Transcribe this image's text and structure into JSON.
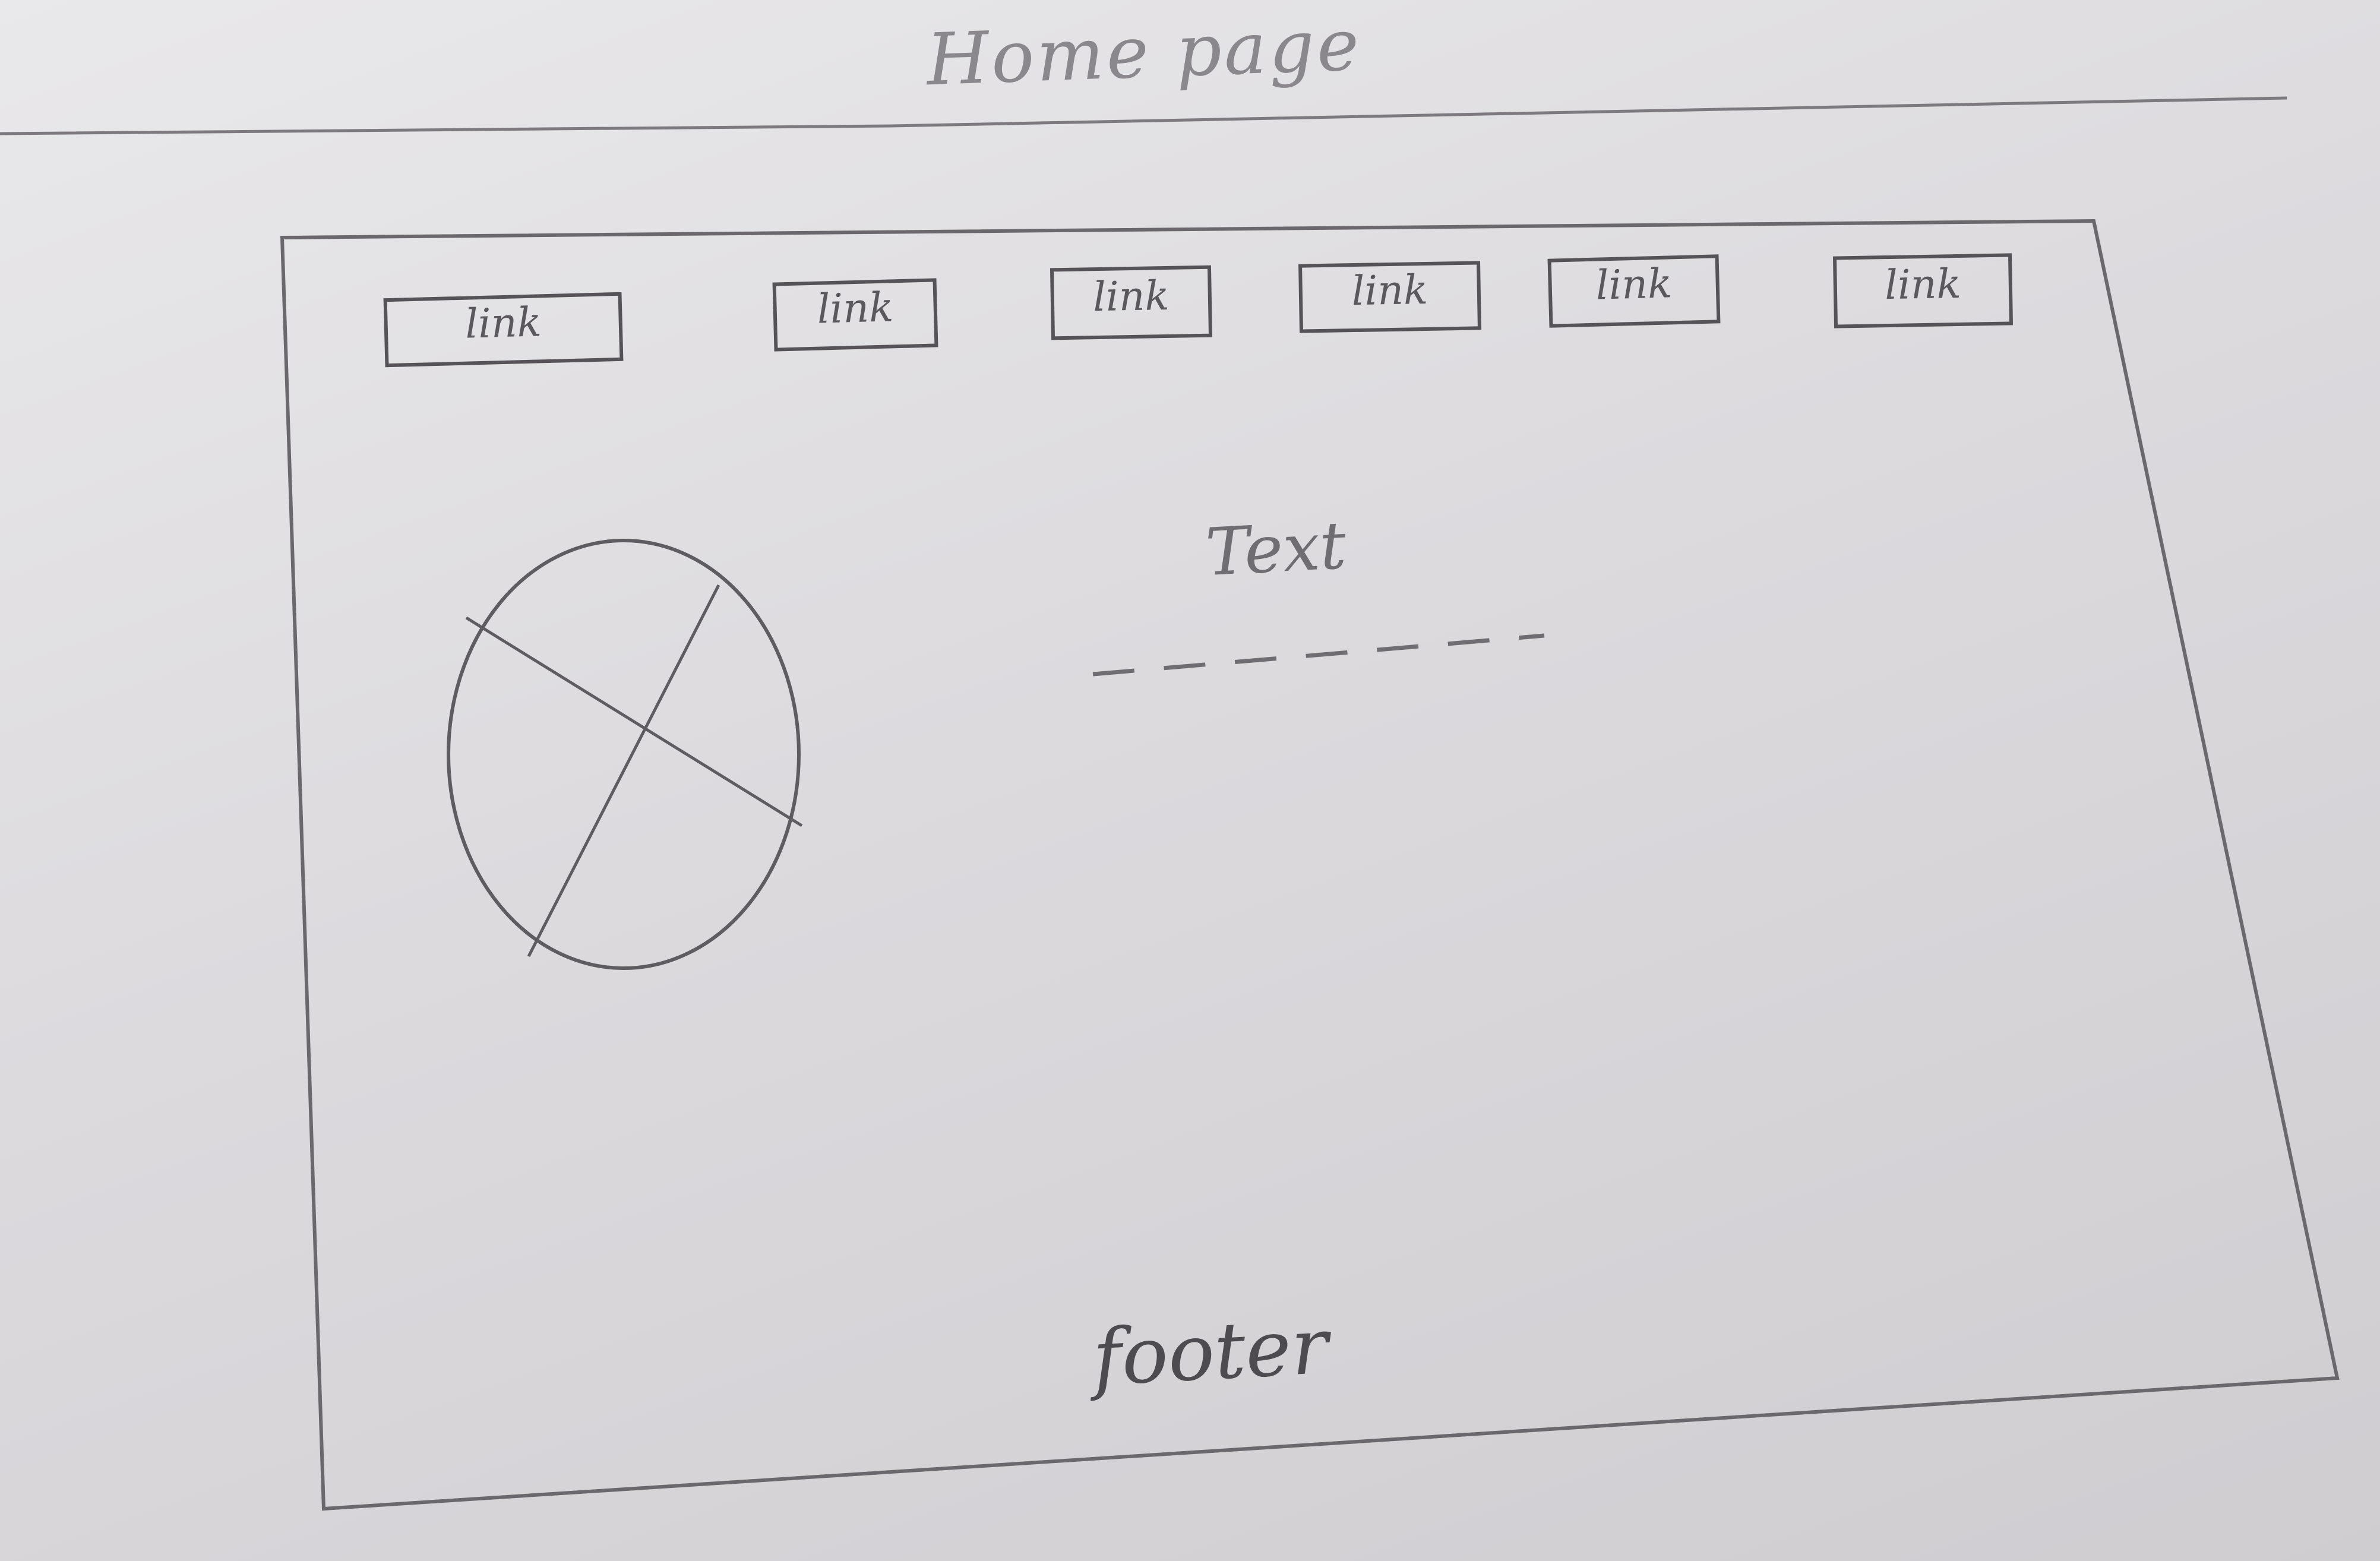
{
  "page": {
    "title": "Home page"
  },
  "nav": {
    "links": [
      "link",
      "link",
      "link",
      "link",
      "link",
      "link"
    ]
  },
  "content": {
    "text": "Text"
  },
  "footer": {
    "text": "footer"
  },
  "colors": {
    "paper": "#e2e0e3",
    "pencil": "#5a585c"
  }
}
